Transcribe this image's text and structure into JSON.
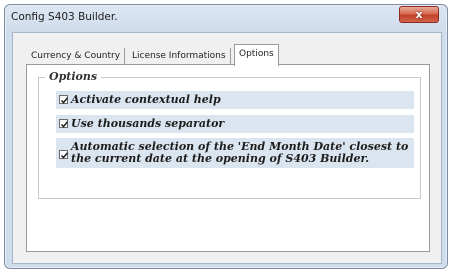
{
  "window": {
    "title": "Config S403 Builder.",
    "close_glyph": "x"
  },
  "tabs": [
    {
      "label": "Currency & Country"
    },
    {
      "label": "License Informations"
    },
    {
      "label": "Options"
    }
  ],
  "options_group": {
    "legend": "Options",
    "items": [
      {
        "label": "Activate contextual help",
        "checked": true
      },
      {
        "label": "Use thousands separator",
        "checked": true
      },
      {
        "label": "Automatic selection of the 'End Month Date' closest to the current date at the opening of S403 Builder.",
        "checked": true
      }
    ]
  }
}
